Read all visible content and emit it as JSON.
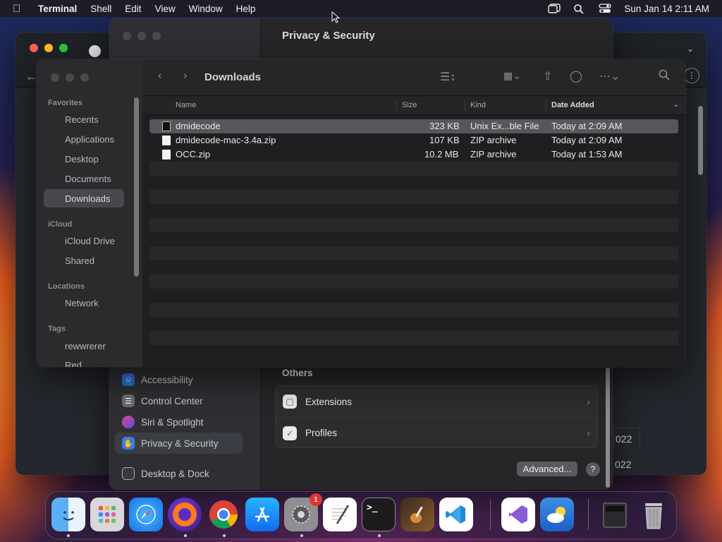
{
  "menubar": {
    "app": "Terminal",
    "items": [
      "Shell",
      "Edit",
      "View",
      "Window",
      "Help"
    ],
    "clock": "Sun Jan 14  2:11 AM"
  },
  "settings": {
    "title": "Privacy & Security",
    "sidebar": [
      {
        "label": "Accessibility",
        "color": "#2f6fd6"
      },
      {
        "label": "Control Center",
        "color": "#6b6b70"
      },
      {
        "label": "Siri & Spotlight",
        "color": "#b0447a"
      },
      {
        "label": "Privacy & Security",
        "color": "#3d7be0",
        "selected": true
      },
      {
        "label": "Desktop & Dock",
        "color": "#3a3a3e"
      }
    ],
    "others_label": "Others",
    "rows": [
      "Extensions",
      "Profiles"
    ],
    "advanced_label": "Advanced...",
    "help_label": "?"
  },
  "finder": {
    "title": "Downloads",
    "sections": {
      "favorites": "Favorites",
      "icloud": "iCloud",
      "locations": "Locations",
      "tags": "Tags"
    },
    "favorites": [
      "Recents",
      "Applications",
      "Desktop",
      "Documents",
      "Downloads"
    ],
    "icloud_items": [
      "iCloud Drive",
      "Shared"
    ],
    "locations_items": [
      "Network"
    ],
    "tags_items": [
      "rewwrerer",
      "Red"
    ],
    "columns": {
      "name": "Name",
      "size": "Size",
      "kind": "Kind",
      "date": "Date Added"
    },
    "files": [
      {
        "name": "dmidecode",
        "size": "323 KB",
        "kind": "Unix Ex...ble File",
        "date": "Today at 2:09 AM"
      },
      {
        "name": "dmidecode-mac-3.4a.zip",
        "size": "107 KB",
        "kind": "ZIP archive",
        "date": "Today at 2:09 AM"
      },
      {
        "name": "OCC.zip",
        "size": "10.2 MB",
        "kind": "ZIP archive",
        "date": "Today at 1:53 AM"
      }
    ]
  },
  "back_window": {
    "year_1": "022",
    "year_2": "022"
  },
  "dock": {
    "settings_badge": "1",
    "terminal_prompt": ">_"
  }
}
